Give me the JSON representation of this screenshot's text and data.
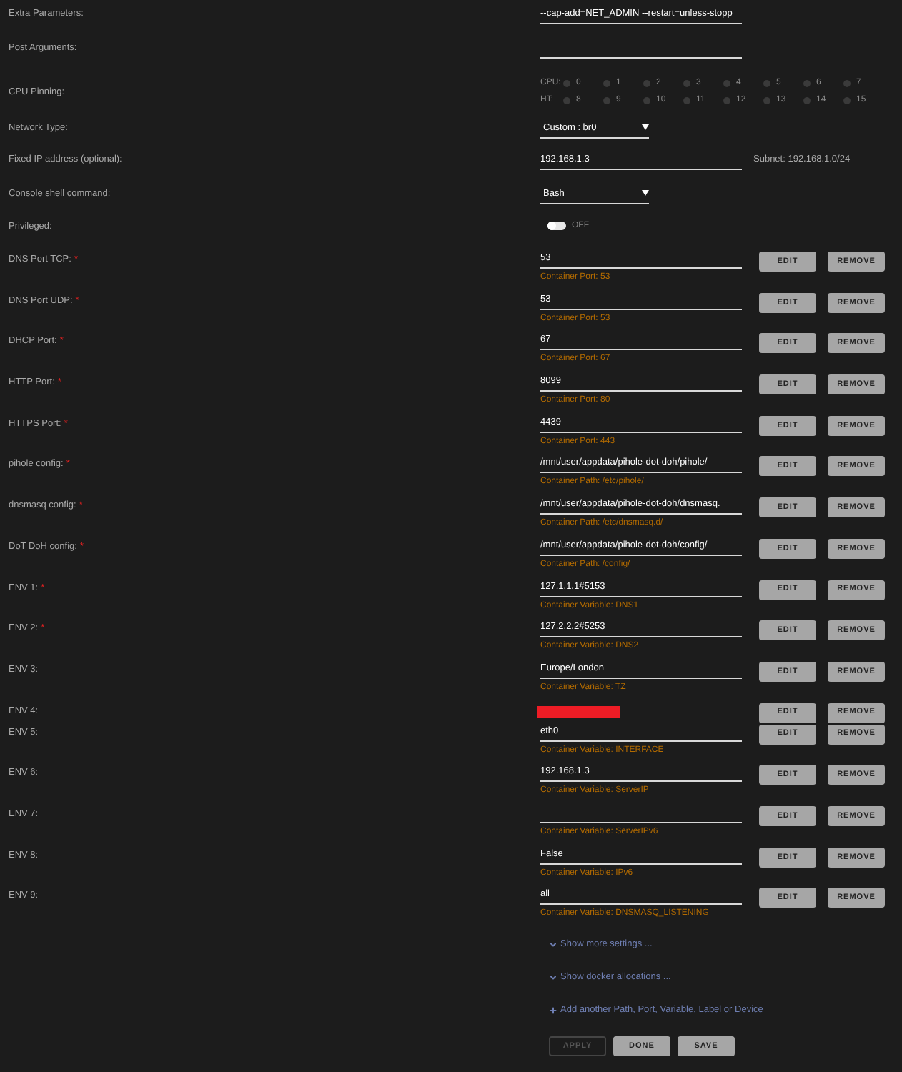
{
  "settings": [
    {
      "kind": "text",
      "label": "Extra Parameters:",
      "value": "--cap-add=NET_ADMIN --restart=unless-stopp"
    },
    {
      "kind": "text",
      "label": "Post Arguments:"
    },
    {
      "kind": "cpu",
      "label": "CPU Pinning:",
      "groups": [
        {
          "label": "CPU:",
          "cores": [
            {
              "label": "0",
              "checked": false
            },
            {
              "label": "1",
              "checked": false
            },
            {
              "label": "2",
              "checked": false
            },
            {
              "label": "3",
              "checked": false
            },
            {
              "label": "4",
              "checked": false
            },
            {
              "label": "5",
              "checked": false
            },
            {
              "label": "6",
              "checked": false
            },
            {
              "label": "7",
              "checked": false
            }
          ]
        },
        {
          "label": "HT:",
          "cores": [
            {
              "label": "8",
              "checked": false
            },
            {
              "label": "9",
              "checked": false
            },
            {
              "label": "10",
              "checked": false
            },
            {
              "label": "11",
              "checked": false
            },
            {
              "label": "12",
              "checked": false
            },
            {
              "label": "13",
              "checked": false
            },
            {
              "label": "14",
              "checked": false
            },
            {
              "label": "15",
              "checked": false
            }
          ]
        }
      ]
    },
    {
      "kind": "select",
      "label": "Network Type:",
      "value": "Custom : br0"
    },
    {
      "kind": "text",
      "label": "Fixed IP address (optional):",
      "value": "192.168.1.3",
      "note": "Subnet: 192.168.1.0/24"
    },
    {
      "kind": "select",
      "label": "Console shell command:",
      "value": "Bash"
    },
    {
      "kind": "toggle",
      "label": "Privileged:",
      "on": false,
      "state_text": "OFF"
    }
  ],
  "config": [
    {
      "label": "DNS Port TCP:",
      "required_mark": "*",
      "value": "53",
      "detail": "Container Port: 53",
      "buttons": [
        "EDIT",
        "REMOVE"
      ]
    },
    {
      "label": "DNS Port UDP:",
      "required_mark": "*",
      "value": "53",
      "detail": "Container Port: 53",
      "buttons": [
        "EDIT",
        "REMOVE"
      ]
    },
    {
      "label": "DHCP Port:",
      "required_mark": "*",
      "value": "67",
      "detail": "Container Port: 67",
      "buttons": [
        "EDIT",
        "REMOVE"
      ]
    },
    {
      "label": "HTTP Port:",
      "required_mark": "*",
      "value": "8099",
      "detail": "Container Port: 80",
      "buttons": [
        "EDIT",
        "REMOVE"
      ]
    },
    {
      "label": "HTTPS Port:",
      "required_mark": "*",
      "value": "4439",
      "detail": "Container Port: 443",
      "buttons": [
        "EDIT",
        "REMOVE"
      ]
    },
    {
      "label": "pihole config:",
      "required_mark": "*",
      "value": "/mnt/user/appdata/pihole-dot-doh/pihole/",
      "detail": "Container Path: /etc/pihole/",
      "buttons": [
        "EDIT",
        "REMOVE"
      ]
    },
    {
      "label": "dnsmasq config:",
      "required_mark": "*",
      "value": "/mnt/user/appdata/pihole-dot-doh/dnsmasq.",
      "detail": "Container Path: /etc/dnsmasq.d/",
      "buttons": [
        "EDIT",
        "REMOVE"
      ]
    },
    {
      "label": "DoT DoH config:",
      "required_mark": "*",
      "value": "/mnt/user/appdata/pihole-dot-doh/config/",
      "detail": "Container Path: /config/",
      "buttons": [
        "EDIT",
        "REMOVE"
      ]
    },
    {
      "label": "ENV 1:",
      "required_mark": "*",
      "value": "127.1.1.1#5153",
      "detail": "Container Variable: DNS1",
      "buttons": [
        "EDIT",
        "REMOVE"
      ]
    },
    {
      "label": "ENV 2:",
      "required_mark": "*",
      "value": "127.2.2.2#5253",
      "detail": "Container Variable: DNS2",
      "buttons": [
        "EDIT",
        "REMOVE"
      ]
    },
    {
      "label": "ENV 3:",
      "value": "Europe/London",
      "detail": "Container Variable: TZ",
      "buttons": [
        "EDIT",
        "REMOVE"
      ]
    },
    {
      "label": "ENV 4:",
      "redacted": true,
      "buttons": [
        "EDIT",
        "REMOVE"
      ]
    },
    {
      "label": "ENV 5:",
      "value": "eth0",
      "detail": "Container Variable: INTERFACE",
      "buttons": [
        "EDIT",
        "REMOVE"
      ]
    },
    {
      "label": "ENV 6:",
      "value": "192.168.1.3",
      "detail": "Container Variable: ServerIP",
      "buttons": [
        "EDIT",
        "REMOVE"
      ]
    },
    {
      "label": "ENV 7:",
      "detail": "Container Variable: ServerIPv6",
      "buttons": [
        "EDIT",
        "REMOVE"
      ]
    },
    {
      "label": "ENV 8:",
      "value": "False",
      "detail": "Container Variable: IPv6",
      "buttons": [
        "EDIT",
        "REMOVE"
      ]
    },
    {
      "label": "ENV 9:",
      "value": "all",
      "detail": "Container Variable: DNSMASQ_LISTENING",
      "buttons": [
        "EDIT",
        "REMOVE"
      ]
    }
  ],
  "links": [
    {
      "kind": "expand",
      "text": "Show more settings ..."
    },
    {
      "kind": "expand",
      "text": "Show docker allocations ..."
    },
    {
      "kind": "add",
      "text": "Add another Path, Port, Variable, Label or Device"
    }
  ],
  "actions": [
    {
      "label": "APPLY",
      "disabled": true
    },
    {
      "label": "DONE",
      "disabled": false
    },
    {
      "label": "SAVE",
      "disabled": false
    }
  ]
}
